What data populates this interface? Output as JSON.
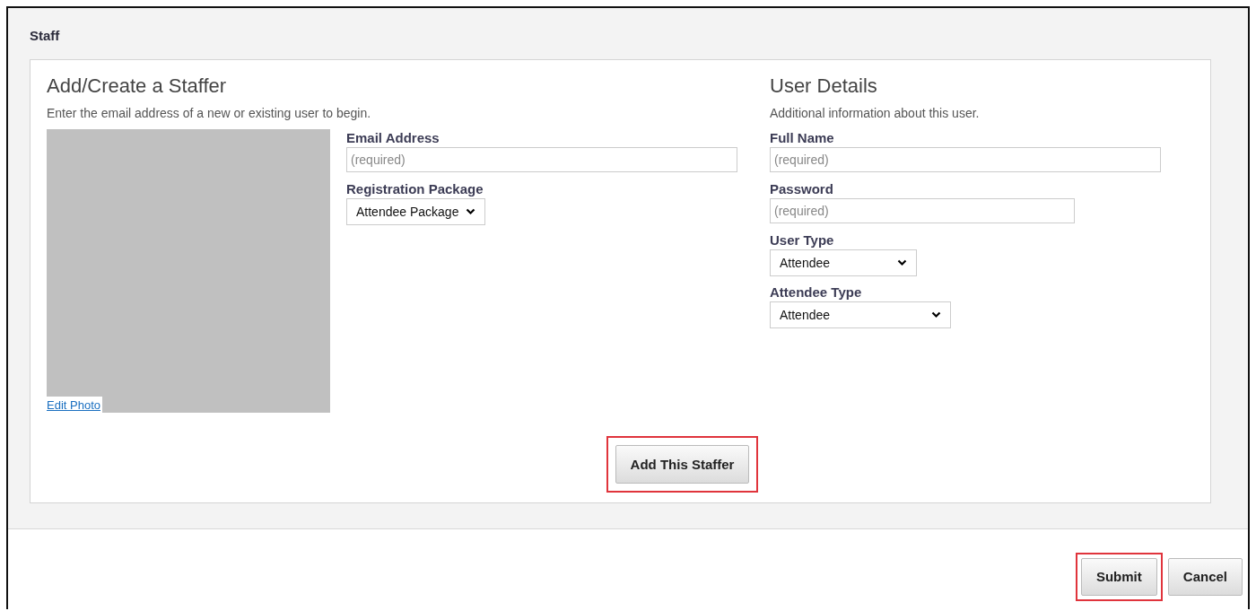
{
  "panel": {
    "title": "Staff"
  },
  "staffer": {
    "heading": "Add/Create a Staffer",
    "subtitle": "Enter the email address of a new or existing user to begin.",
    "photo": {
      "kind": "placeholder",
      "link": "Edit Photo"
    },
    "fields": [
      {
        "kind": "input",
        "label": "Email Address",
        "placeholder": "(required)"
      },
      {
        "kind": "select",
        "label": "Registration Package",
        "value": "Attendee Package"
      }
    ],
    "button": {
      "label": "Add This Staffer",
      "highlighted": true
    }
  },
  "details": {
    "heading": "User Details",
    "subtitle": "Additional information about this user.",
    "fields": [
      {
        "kind": "input",
        "label": "Full Name",
        "placeholder": "(required)"
      },
      {
        "kind": "input",
        "label": "Password",
        "placeholder": "(required)"
      },
      {
        "kind": "select",
        "label": "User Type",
        "value": "Attendee"
      },
      {
        "kind": "select",
        "label": "Attendee Type",
        "value": "Attendee"
      }
    ]
  },
  "footer_buttons": [
    {
      "label": "Submit",
      "highlighted": true
    },
    {
      "label": "Cancel",
      "highlighted": false
    }
  ]
}
